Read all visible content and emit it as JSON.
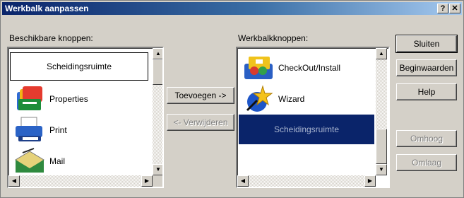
{
  "window": {
    "title": "Werkbalk aanpassen",
    "help_glyph": "?",
    "close_glyph": "✕"
  },
  "available": {
    "label": "Beschikbare knoppen:",
    "items": [
      {
        "label": "Scheidingsruimte"
      },
      {
        "label": "Properties",
        "icon": "properties-icon"
      },
      {
        "label": "Print",
        "icon": "print-icon"
      },
      {
        "label": "Mail",
        "icon": "mail-icon"
      }
    ]
  },
  "toolbar_buttons": {
    "label": "Werkbalkknoppen:",
    "items": [
      {
        "label": "CheckOut/Install",
        "icon": "checkout-install-icon"
      },
      {
        "label": "Wizard",
        "icon": "wizard-icon"
      },
      {
        "label": "Scheidingsruimte",
        "selected": true
      }
    ]
  },
  "buttons": {
    "add": "Toevoegen ->",
    "remove": "<- Verwijderen",
    "close": "Sluiten",
    "reset": "Beginwaarden",
    "help": "Help",
    "up": "Omhoog",
    "down": "Omlaag"
  },
  "arrows": {
    "up": "▲",
    "down": "▼",
    "left": "◀",
    "right": "▶"
  }
}
